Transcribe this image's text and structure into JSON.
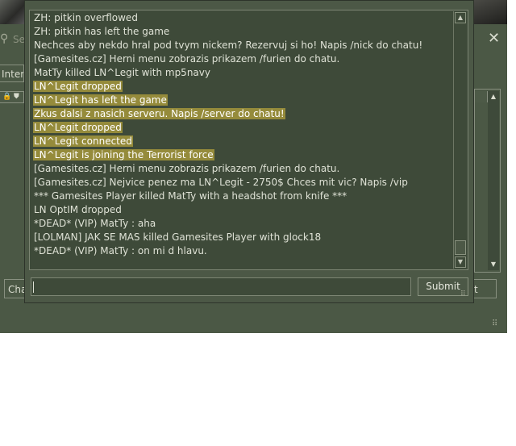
{
  "background_window": {
    "search_placeholder": "Se",
    "tab_label": "Inter",
    "chat_button_label": "Cha",
    "connect_button_label": "t",
    "close_glyph": "✕",
    "search_glyph": "⚲",
    "lock_glyph": "🔒",
    "shield_glyph": "⛊",
    "grip_glyph": "⠿"
  },
  "chat_dialog": {
    "lines": [
      {
        "text": "ZH: pitkin overflowed",
        "highlight": false
      },
      {
        "text": "ZH: pitkin has left the game",
        "highlight": false
      },
      {
        "text": "Nechces aby nekdo hral pod tvym nickem? Rezervuj si ho! Napis /nick do chatu!",
        "highlight": false
      },
      {
        "text": "[Gamesites.cz] Herni menu zobrazis prikazem /furien do chatu.",
        "highlight": false
      },
      {
        "text": "MatTy killed LN^Legit with mp5navy",
        "highlight": false
      },
      {
        "text": "LN^Legit dropped",
        "highlight": true
      },
      {
        "text": "LN^Legit has left the game",
        "highlight": true
      },
      {
        "text": "Zkus dalsi z nasich serveru. Napis /server do chatu!",
        "highlight": true
      },
      {
        "text": "LN^Legit dropped",
        "highlight": true
      },
      {
        "text": "LN^Legit connected",
        "highlight": true
      },
      {
        "text": "LN^Legit is joining the Terrorist force",
        "highlight": true
      },
      {
        "text": "[Gamesites.cz] Herni menu zobrazis prikazem /furien do chatu.",
        "highlight": false
      },
      {
        "text": "[Gamesites.cz] Nejvice penez ma LN^Legit - 2750$ Chces mit vic? Napis /vip",
        "highlight": false
      },
      {
        "text": "*** Gamesites Player killed MatTy with a headshot from knife ***",
        "highlight": false
      },
      {
        "text": "LN OptIM dropped",
        "highlight": false
      },
      {
        "text": "*DEAD* (VIP) MatTy : aha",
        "highlight": false
      },
      {
        "text": "[LOLMAN] JAK SE MAS killed Gamesites Player with glock18",
        "highlight": false
      },
      {
        "text": "*DEAD* (VIP) MatTy : on mi d hlavu.",
        "highlight": false
      }
    ],
    "input_value": "",
    "submit_label": "Submit",
    "scroll_up_glyph": "▲",
    "scroll_down_glyph": "▼",
    "grip_glyph": "⠿"
  },
  "colors": {
    "panel": "#4c5846",
    "text_area": "#3e4a39",
    "highlight": "#958b3b",
    "text": "#dfe2d6"
  }
}
